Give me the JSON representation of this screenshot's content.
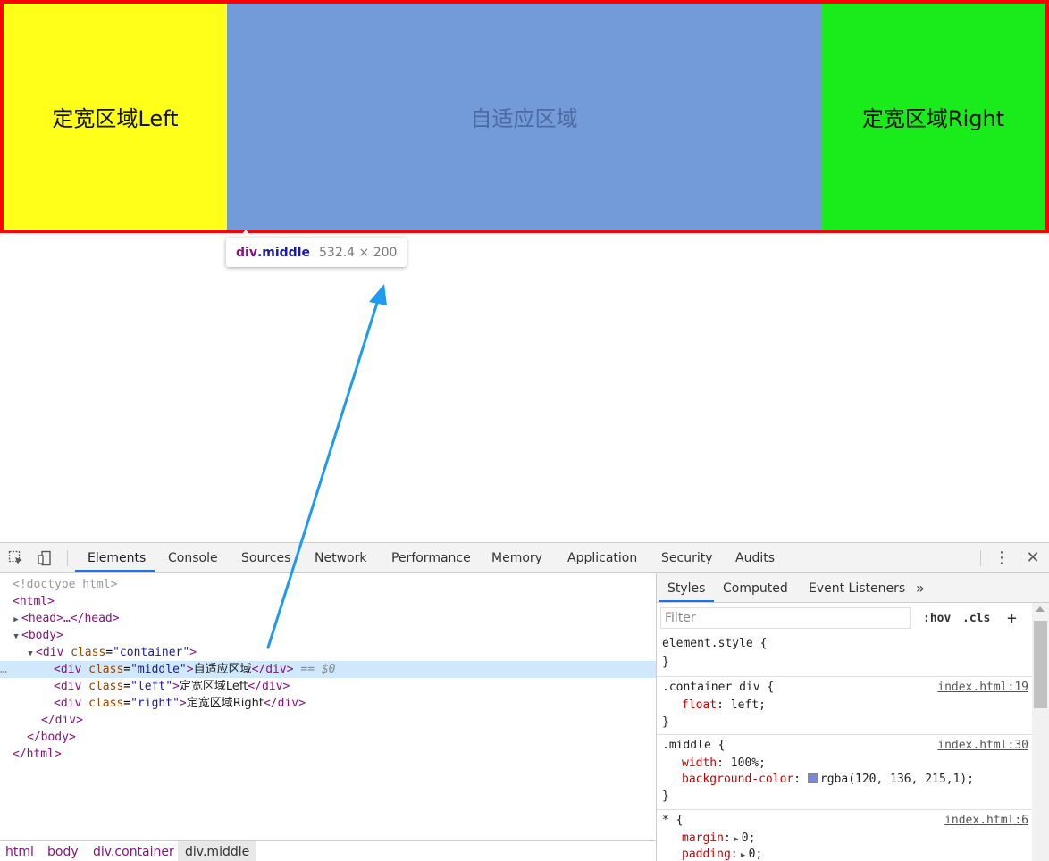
{
  "viewport": {
    "left_label": "定宽区域Left",
    "middle_label": "自适应区域",
    "right_label": "定宽区域Right",
    "colors": {
      "container_border": "#ff0000",
      "left_bg": "#ffff1a",
      "middle_bg": "#739bd9",
      "right_bg": "#1aeb1a"
    }
  },
  "tooltip": {
    "tag": "div",
    "cls": ".middle",
    "dims": "532.4 × 200"
  },
  "devtools": {
    "tabs": [
      "Elements",
      "Console",
      "Sources",
      "Network",
      "Performance",
      "Memory",
      "Application",
      "Security",
      "Audits"
    ],
    "active_tab": "Elements",
    "icons": {
      "inspect": "inspect-element-icon",
      "device": "device-toolbar-icon",
      "menu": "kebab-menu-icon",
      "close": "close-icon"
    },
    "dom": {
      "doctype": "<!doctype html>",
      "html_open": "<html>",
      "head": "<head>…</head>",
      "body_open": "<body>",
      "container_open_tag": "div",
      "container_attr": "class",
      "container_val": "\"container\"",
      "middle_val": "\"middle\"",
      "middle_text": "自适应区域",
      "selected_marker": "== $0",
      "left_val": "\"left\"",
      "left_text": "定宽区域Left",
      "right_val": "\"right\"",
      "right_text": "定宽区域Right",
      "div_close": "</div>",
      "body_close": "</body>",
      "html_close": "</html>"
    },
    "breadcrumbs": [
      "html",
      "body",
      "div.container",
      "div.middle"
    ],
    "styles": {
      "tabs": [
        "Styles",
        "Computed",
        "Event Listeners"
      ],
      "filter_placeholder": "Filter",
      "hov": ":hov",
      "cls": ".cls",
      "rules": [
        {
          "selector": "element.style {",
          "source": ""
        },
        {
          "selector": ".container div {",
          "source": "index.html:19",
          "props": [
            {
              "name": "float",
              "value": "left;"
            }
          ]
        },
        {
          "selector": ".middle {",
          "source": "index.html:30",
          "props": [
            {
              "name": "width",
              "value": "100%;"
            },
            {
              "name": "background-color",
              "value": "rgba(120, 136, 215,1);"
            }
          ]
        },
        {
          "selector": "* {",
          "source": "index.html:6",
          "props": [
            {
              "name": "margin",
              "value": "0;"
            },
            {
              "name": "padding",
              "value": "0;"
            }
          ]
        }
      ],
      "swatch_color": "#7888d7"
    }
  }
}
